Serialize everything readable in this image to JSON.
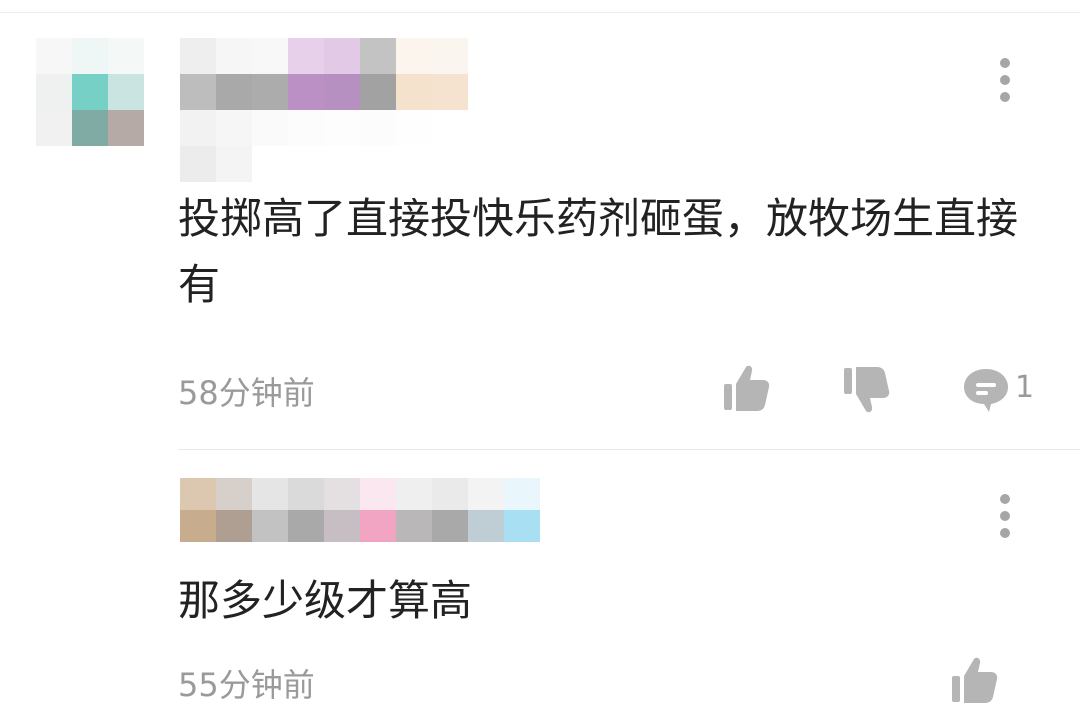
{
  "comments": [
    {
      "text": "投掷高了直接投快乐药剂砸蛋，放牧场生直接有",
      "time": "58分钟前",
      "reply_count": "1",
      "icons": [
        "avatar",
        "more-vertical-icon",
        "thumbs-up-icon",
        "thumbs-down-icon",
        "reply-bubble-icon"
      ]
    },
    {
      "text": "那多少级才算高",
      "time": "55分钟前",
      "icons": [
        "more-vertical-icon",
        "thumbs-up-icon"
      ]
    }
  ],
  "colors": {
    "text": "#222222",
    "muted": "#9a9a9a",
    "icon": "#b5b5b5",
    "divider": "#ececec"
  }
}
